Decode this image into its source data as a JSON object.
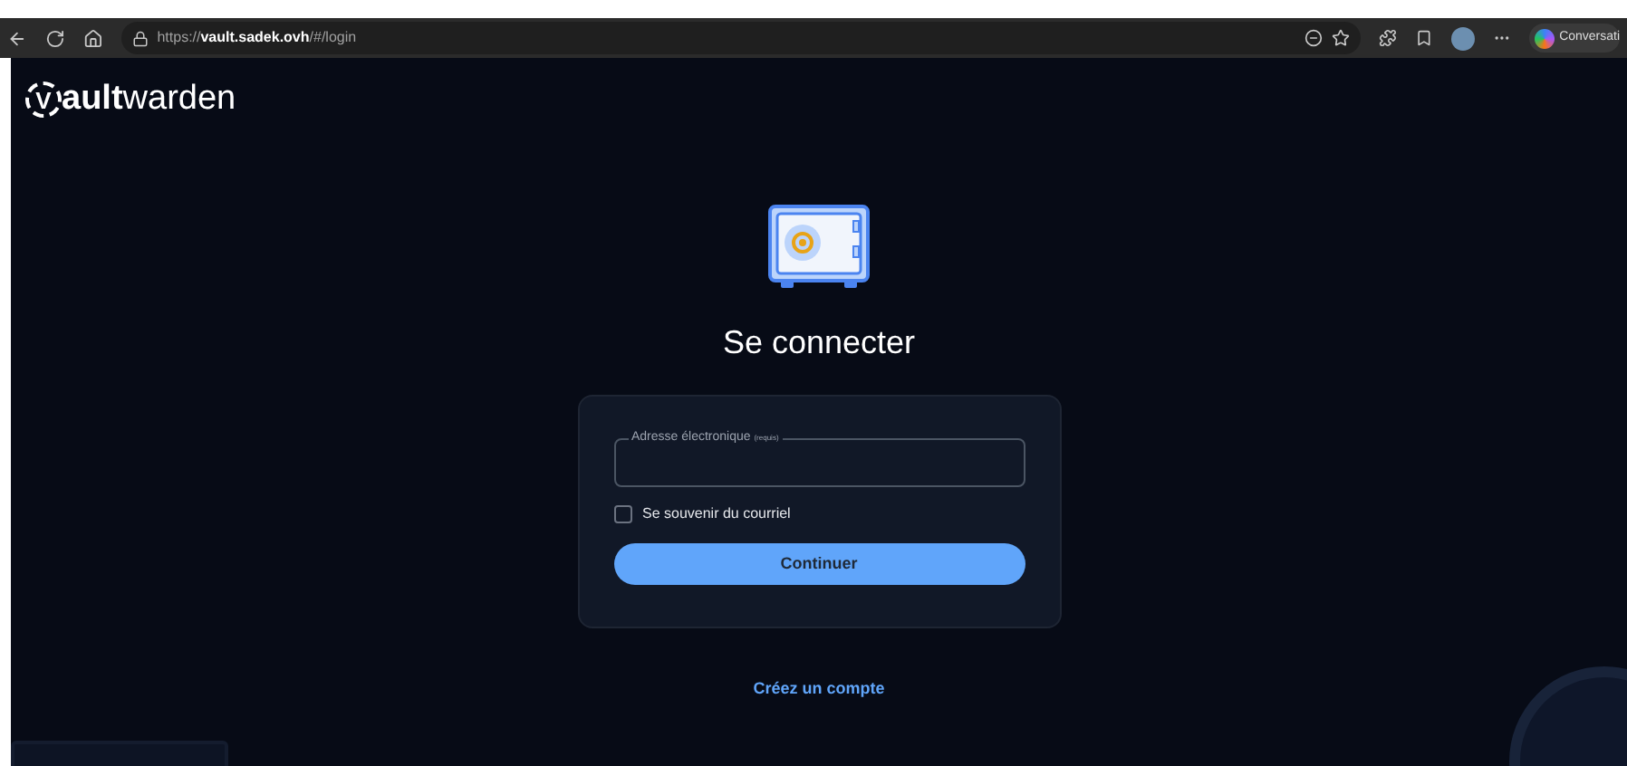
{
  "browser": {
    "url": "https://**vault.sadek.ovh**/#/login",
    "profile_button": "Conversati"
  },
  "logo": {
    "mark": "V",
    "bold": "ault",
    "rest": "warden"
  },
  "title": "Se connecter",
  "form": {
    "email_label": "Adresse électronique",
    "email_required": "(requis)",
    "remember": {
      "label": "Se souvenir du courriel",
      "checked": false
    },
    "submit": "Continuer"
  },
  "create_account": "Créez un compte"
}
